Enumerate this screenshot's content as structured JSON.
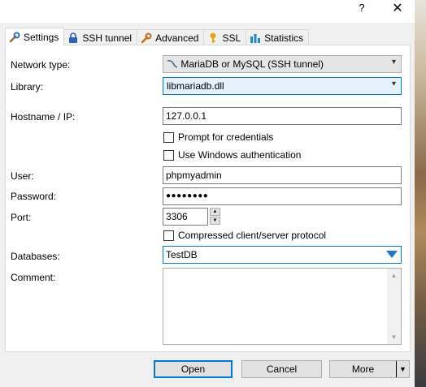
{
  "titlebar": {
    "help_label": "?",
    "close_label": "✕"
  },
  "tabs": [
    {
      "label": "Settings",
      "icon": "wrench-icon",
      "active": true
    },
    {
      "label": "SSH tunnel",
      "icon": "lock-icon"
    },
    {
      "label": "Advanced",
      "icon": "wrench-icon"
    },
    {
      "label": "SSL",
      "icon": "key-icon"
    },
    {
      "label": "Statistics",
      "icon": "bar-chart-icon"
    }
  ],
  "form": {
    "network_type": {
      "label": "Network type:",
      "value": "MariaDB or MySQL (SSH tunnel)"
    },
    "library": {
      "label": "Library:",
      "value": "libmariadb.dll"
    },
    "hostname": {
      "label": "Hostname / IP:",
      "value": "127.0.0.1"
    },
    "prompt_credentials": {
      "label": "Prompt for credentials",
      "checked": false
    },
    "windows_auth": {
      "label": "Use Windows authentication",
      "checked": false
    },
    "user": {
      "label": "User:",
      "value": "phpmyadmin"
    },
    "password": {
      "label": "Password:",
      "value": "●●●●●●●●"
    },
    "port": {
      "label": "Port:",
      "value": "3306"
    },
    "compressed": {
      "label": "Compressed client/server protocol",
      "checked": false
    },
    "databases": {
      "label": "Databases:",
      "value": "TestDB"
    },
    "comment": {
      "label": "Comment:",
      "value": ""
    }
  },
  "buttons": {
    "open": "Open",
    "cancel": "Cancel",
    "more": "More",
    "more_arrow": "▼"
  }
}
